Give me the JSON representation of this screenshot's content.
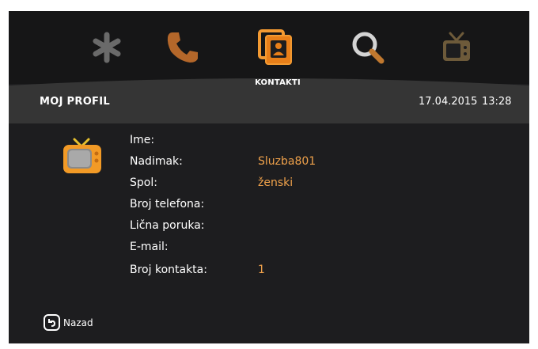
{
  "nav": {
    "items": [
      {
        "icon": "asterisk-icon",
        "active": false
      },
      {
        "icon": "phone-icon",
        "active": false
      },
      {
        "icon": "contacts-icon",
        "active": true,
        "label": "KONTAKTI"
      },
      {
        "icon": "search-icon",
        "active": false
      },
      {
        "icon": "tv-icon",
        "active": false
      }
    ]
  },
  "header": {
    "title": "MOJ PROFIL",
    "date": "17.04.2015",
    "time": "13:28"
  },
  "profile": {
    "avatar_icon": "tv-avatar-icon",
    "fields": [
      {
        "label": "Ime:",
        "value": ""
      },
      {
        "label": "Nadimak:",
        "value": "Sluzba801"
      },
      {
        "label": "Spol:",
        "value": "ženski"
      },
      {
        "label": "Broj telefona:",
        "value": ""
      },
      {
        "label": "Lična poruka:",
        "value": ""
      },
      {
        "label": "E-mail:",
        "value": ""
      },
      {
        "label": "Broj kontakta:",
        "value": "1"
      }
    ]
  },
  "footer": {
    "back_label": "Nazad",
    "back_icon": "back-key-icon"
  },
  "colors": {
    "accent": "#f0a24b",
    "background": "#1d1d1f",
    "header_band": "#353535"
  }
}
